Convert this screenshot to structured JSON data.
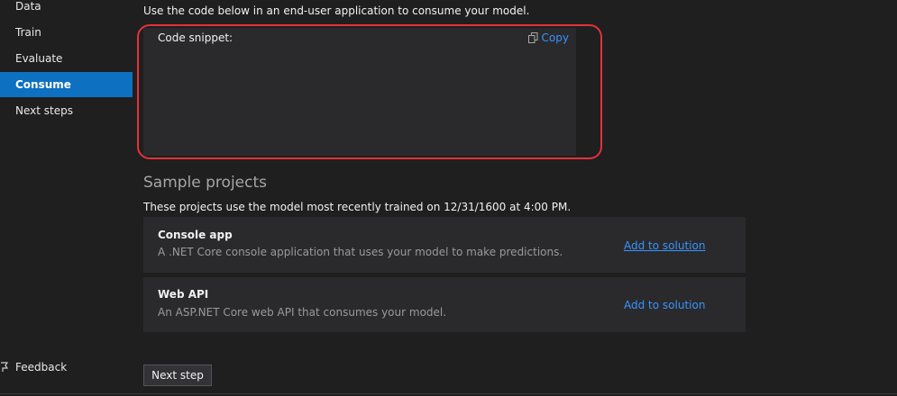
{
  "sidebar": {
    "items": [
      {
        "label": "Data",
        "active": false
      },
      {
        "label": "Train",
        "active": false
      },
      {
        "label": "Evaluate",
        "active": false
      },
      {
        "label": "Consume",
        "active": true
      },
      {
        "label": "Next steps",
        "active": false
      }
    ],
    "feedback_label": "Feedback"
  },
  "main": {
    "intro": "Use the code below in an end-user application to consume your model.",
    "snippet": {
      "label": "Code snippet:",
      "copy_label": "Copy"
    },
    "samples": {
      "title": "Sample projects",
      "description": "These projects use the model most recently trained on 12/31/1600 at 4:00 PM.",
      "projects": [
        {
          "title": "Console app",
          "description": "A .NET Core console application that uses your model to make predictions.",
          "action": "Add to solution"
        },
        {
          "title": "Web API",
          "description": "An ASP.NET Core web API that consumes your model.",
          "action": "Add to solution"
        }
      ]
    },
    "next_step_label": "Next step"
  },
  "colors": {
    "background": "#1f1f1f",
    "panel": "#2a2a2c",
    "accent": "#0e70c0",
    "link": "#3794ff",
    "highlight": "#e3313a"
  },
  "icons": {
    "copy": "copy-icon",
    "feedback": "feedback-icon"
  }
}
